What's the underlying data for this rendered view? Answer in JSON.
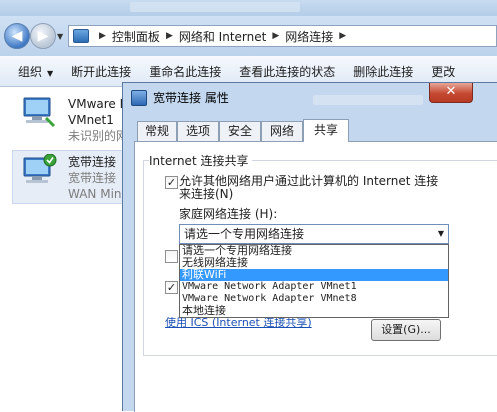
{
  "explorer": {
    "breadcrumb": [
      "控制面板",
      "网络和 Internet",
      "网络连接"
    ],
    "toolbar": [
      {
        "label": "组织",
        "has_dropdown": true
      },
      {
        "label": "断开此连接"
      },
      {
        "label": "重命名此连接"
      },
      {
        "label": "查看此连接的状态"
      },
      {
        "label": "删除此连接"
      },
      {
        "label": "更改"
      }
    ],
    "connections": [
      {
        "line1": "VMware N",
        "line2": "VMnet1",
        "line3": "未识别的网"
      },
      {
        "line1": "宽带连接",
        "line2": "宽带连接",
        "line3": "WAN Min"
      }
    ]
  },
  "dialog": {
    "title": "宽带连接 属性",
    "close_symbol": "✕",
    "tabs": [
      "常规",
      "选项",
      "安全",
      "网络",
      "共享"
    ],
    "active_tab": "共享",
    "group_title": "Internet 连接共享",
    "allow_sharing": {
      "checked": true,
      "check_symbol": "✓",
      "line1": "允许其他网络用户通过此计算机的 Internet 连接",
      "line2": "来连接(N)"
    },
    "home_network_label": "家庭网络连接 (H):",
    "home_network_selected": "请选一个专用网络连接",
    "dropdown_options": [
      "请选一个专用网络连接",
      "无线网络连接",
      "利联WiFi",
      "VMware Network Adapter VMnet1",
      "VMware Network Adapter VMnet8",
      "本地连接"
    ],
    "highlighted_option": "利联WiFi",
    "hidden_checkbox_1": {
      "checked": false
    },
    "hidden_checkbox_2": {
      "checked": true,
      "check_symbol": "✓"
    },
    "ics_link": "使用 ICS (Internet 连接共享)",
    "settings_button": "设置(G)..."
  }
}
